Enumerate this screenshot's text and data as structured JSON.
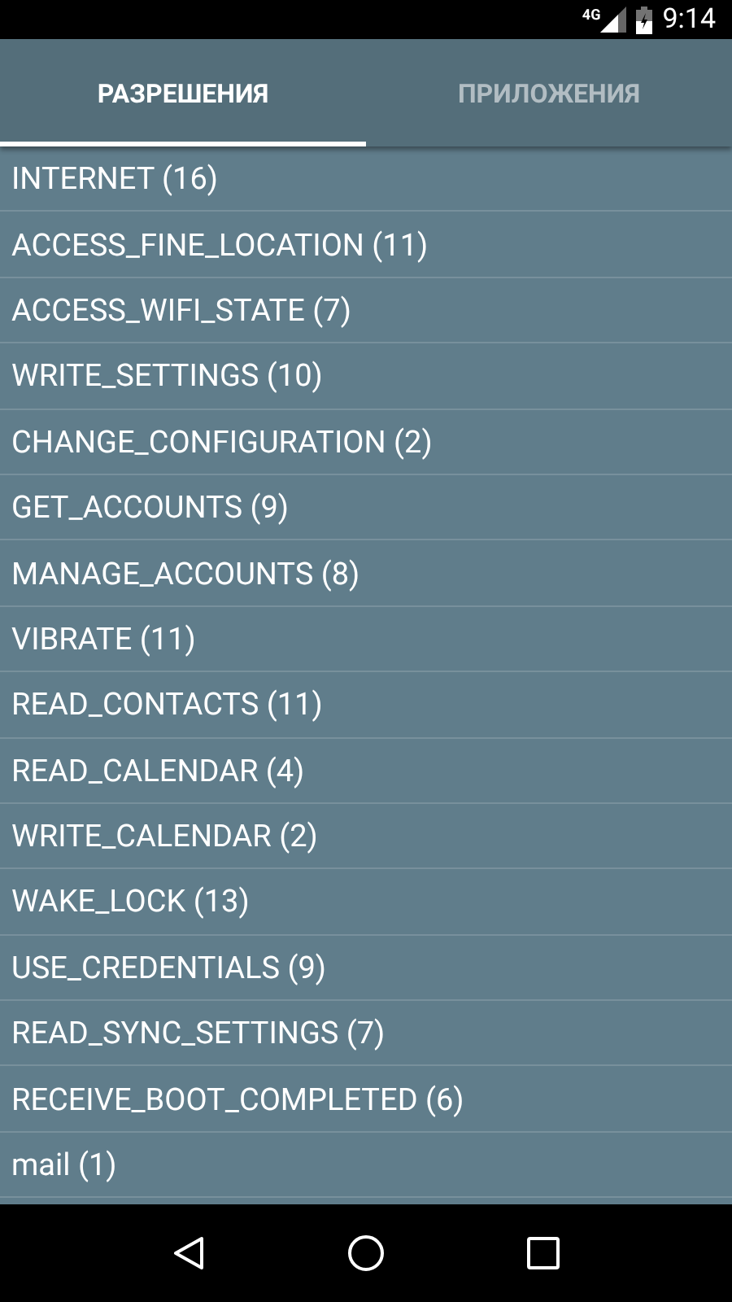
{
  "status_bar": {
    "network": "4G",
    "time": "9:14"
  },
  "tabs": [
    {
      "label": "РАЗРЕШЕНИЯ",
      "selected": true
    },
    {
      "label": "ПРИЛОЖЕНИЯ",
      "selected": false
    }
  ],
  "permissions": [
    {
      "label": "INTERNET (16)"
    },
    {
      "label": "ACCESS_FINE_LOCATION (11)"
    },
    {
      "label": "ACCESS_WIFI_STATE (7)"
    },
    {
      "label": "WRITE_SETTINGS (10)"
    },
    {
      "label": "CHANGE_CONFIGURATION (2)"
    },
    {
      "label": "GET_ACCOUNTS (9)"
    },
    {
      "label": "MANAGE_ACCOUNTS (8)"
    },
    {
      "label": "VIBRATE (11)"
    },
    {
      "label": "READ_CONTACTS (11)"
    },
    {
      "label": "READ_CALENDAR (4)"
    },
    {
      "label": "WRITE_CALENDAR (2)"
    },
    {
      "label": "WAKE_LOCK (13)"
    },
    {
      "label": "USE_CREDENTIALS (9)"
    },
    {
      "label": "READ_SYNC_SETTINGS (7)"
    },
    {
      "label": "RECEIVE_BOOT_COMPLETED (6)"
    },
    {
      "label": "mail (1)"
    }
  ]
}
